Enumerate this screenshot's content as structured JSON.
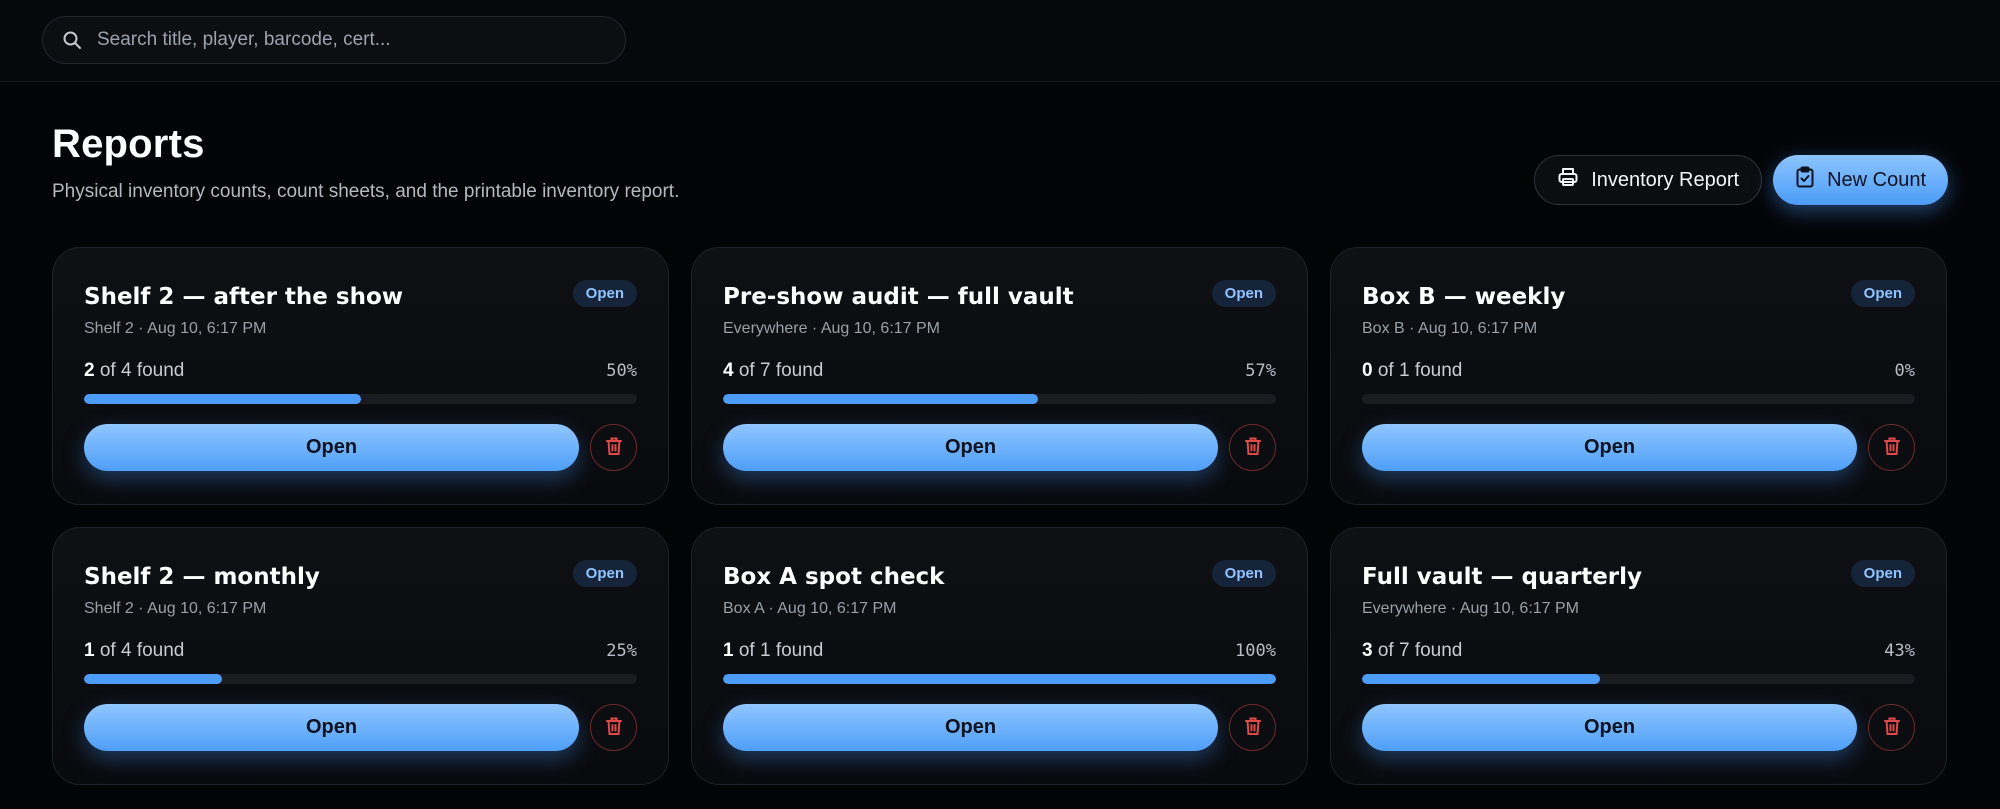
{
  "search": {
    "placeholder": "Search title, player, barcode, cert..."
  },
  "page": {
    "title": "Reports",
    "subtitle": "Physical inventory counts, count sheets, and the printable inventory report."
  },
  "actions": {
    "inventory_report_label": "Inventory Report",
    "new_count_label": "New Count"
  },
  "cards": [
    {
      "title": "Shelf 2 — after the show",
      "meta": "Shelf 2 · Aug 10, 6:17 PM",
      "status": "Open",
      "found": "2",
      "total_text": "of 4 found",
      "pct": "50%",
      "progress": 0.5,
      "open_label": "Open"
    },
    {
      "title": "Pre-show audit — full vault",
      "meta": "Everywhere · Aug 10, 6:17 PM",
      "status": "Open",
      "found": "4",
      "total_text": "of 7 found",
      "pct": "57%",
      "progress": 0.57,
      "open_label": "Open"
    },
    {
      "title": "Box B — weekly",
      "meta": "Box B · Aug 10, 6:17 PM",
      "status": "Open",
      "found": "0",
      "total_text": "of 1 found",
      "pct": "0%",
      "progress": 0,
      "open_label": "Open"
    },
    {
      "title": "Shelf 2 — monthly",
      "meta": "Shelf 2 · Aug 10, 6:17 PM",
      "status": "Open",
      "found": "1",
      "total_text": "of 4 found",
      "pct": "25%",
      "progress": 0.25,
      "open_label": "Open"
    },
    {
      "title": "Box A spot check",
      "meta": "Box A · Aug 10, 6:17 PM",
      "status": "Open",
      "found": "1",
      "total_text": "of 1 found",
      "pct": "100%",
      "progress": 1.0,
      "open_label": "Open"
    },
    {
      "title": "Full vault — quarterly",
      "meta": "Everywhere · Aug 10, 6:17 PM",
      "status": "Open",
      "found": "3",
      "total_text": "of 7 found",
      "pct": "43%",
      "progress": 0.43,
      "open_label": "Open"
    }
  ],
  "colors": {
    "accent": "#4c9cf8",
    "badge_bg": "#16243a",
    "badge_text": "#8fc3ff",
    "danger": "#e04a4a"
  }
}
